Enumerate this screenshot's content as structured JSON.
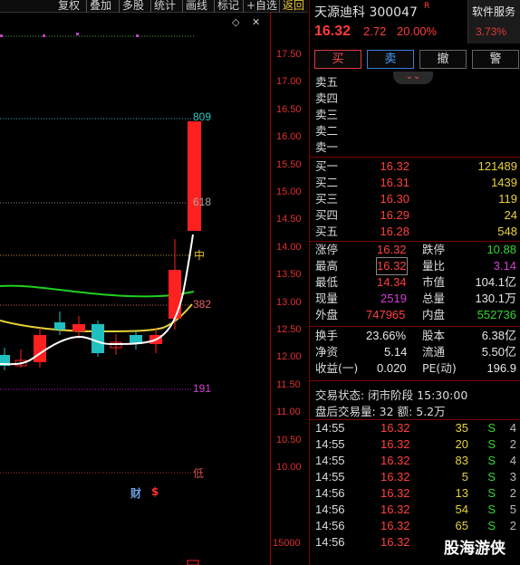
{
  "toolbar": {
    "items": [
      "复权",
      "叠加",
      "多股",
      "统计",
      "画线",
      "标记",
      "+自选",
      "返回"
    ]
  },
  "chart": {
    "price_ticks": [
      "17.50",
      "17.00",
      "16.50",
      "16.00",
      "15.50",
      "15.00",
      "14.50",
      "14.00",
      "13.50",
      "13.00",
      "12.50",
      "12.00",
      "11.50",
      "11.00",
      "10.50",
      "10.00"
    ],
    "volume_tick": "15000",
    "fib_labels": {
      "l809": "809",
      "l618": "618",
      "mid": "中",
      "l382": "382",
      "l191": "191",
      "low": "低"
    },
    "markers": {
      "cai": "财",
      "dollar": "$"
    },
    "colors": {
      "up": "#ff2020",
      "down": "#20c0c0",
      "ma_white": "#ffffff",
      "ma_yellow": "#e6d23a",
      "ma_green": "#20d020"
    }
  },
  "stock": {
    "name_code": "天源迪科 300047",
    "flag": "R",
    "last_price": "16.32",
    "change": "2.72",
    "change_pct": "20.00%",
    "service_label": "软件服务",
    "service_pct": "3.73%"
  },
  "trade_buttons": [
    "买",
    "卖",
    "撤",
    "警"
  ],
  "collapse_icon": "chevron-double-down",
  "sell_book": [
    {
      "label": "卖五"
    },
    {
      "label": "卖四"
    },
    {
      "label": "卖三"
    },
    {
      "label": "卖二"
    },
    {
      "label": "卖一"
    }
  ],
  "buy_book": [
    {
      "label": "买一",
      "price": "16.32",
      "volume": "121489"
    },
    {
      "label": "买二",
      "price": "16.31",
      "volume": "1439"
    },
    {
      "label": "买三",
      "price": "16.30",
      "volume": "119"
    },
    {
      "label": "买四",
      "price": "16.29",
      "volume": "24"
    },
    {
      "label": "买五",
      "price": "16.28",
      "volume": "548"
    }
  ],
  "stats": {
    "limit_up_label": "涨停",
    "limit_up": "16.32",
    "limit_down_label": "跌停",
    "limit_down": "10.88",
    "high_label": "最高",
    "high": "16.32",
    "vol_ratio_label": "量比",
    "vol_ratio": "3.14",
    "low_label": "最低",
    "low": "14.34",
    "mkt_cap_label": "市值",
    "mkt_cap": "104.1亿",
    "current_label": "现量",
    "current": "2519",
    "total_vol_label": "总量",
    "total_vol": "130.1万",
    "outer_label": "外盘",
    "outer": "747965",
    "inner_label": "内盘",
    "inner": "552736",
    "turnover_label": "换手",
    "turnover": "23.66%",
    "shares_label": "股本",
    "shares": "6.38亿",
    "nav_label": "净资",
    "nav": "5.14",
    "float_label": "流通",
    "float": "5.50亿",
    "eps_label": "收益(一)",
    "eps": "0.020",
    "pe_label": "PE(动)",
    "pe": "196.9"
  },
  "status": {
    "trade_state": "交易状态: 闭市阶段 15:30:00",
    "after_hours": "盘后交易量: 32  额: 5.2万"
  },
  "ticks": [
    {
      "time": "14:55",
      "price": "16.32",
      "qty": "35",
      "side": "S",
      "count": "4"
    },
    {
      "time": "14:55",
      "price": "16.32",
      "qty": "20",
      "side": "S",
      "count": "2"
    },
    {
      "time": "14:55",
      "price": "16.32",
      "qty": "83",
      "side": "S",
      "count": "4"
    },
    {
      "time": "14:55",
      "price": "16.32",
      "qty": "5",
      "side": "S",
      "count": "3"
    },
    {
      "time": "14:56",
      "price": "16.32",
      "qty": "13",
      "side": "S",
      "count": "2"
    },
    {
      "time": "14:56",
      "price": "16.32",
      "qty": "54",
      "side": "S",
      "count": "5"
    },
    {
      "time": "14:56",
      "price": "16.32",
      "qty": "65",
      "side": "S",
      "count": "2"
    },
    {
      "time": "14:56",
      "price": "16.32",
      "qty": "",
      "side": "",
      "count": ""
    }
  ],
  "watermark": "股海游侠"
}
